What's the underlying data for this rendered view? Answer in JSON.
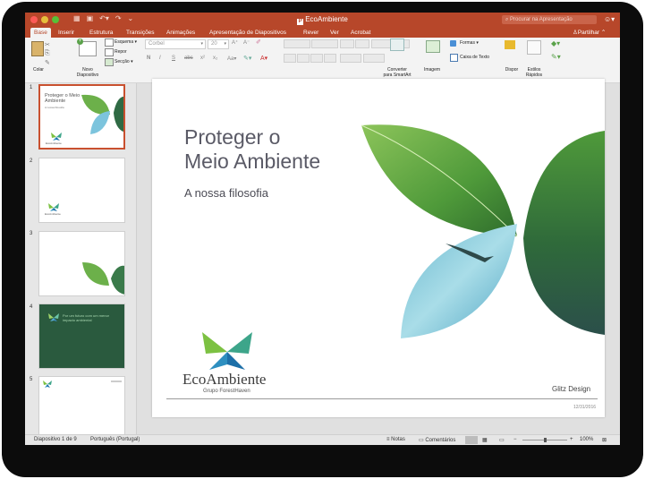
{
  "window": {
    "title": "EcoAmbiente",
    "search_placeholder": "Procurar na Apresentação",
    "share_label": "Partilhar",
    "qat_icons": [
      "grid-icon",
      "save-icon",
      "undo-icon",
      "redo-icon",
      "customize-icon"
    ],
    "accent": "#b7472a"
  },
  "tabs": [
    "Base",
    "Inserir",
    "Estrutura",
    "Transições",
    "Animações",
    "Apresentação de Diapositivos",
    "Rever",
    "Ver",
    "Acrobat"
  ],
  "ribbon": {
    "paste": "Colar",
    "new_slide_line1": "Novo",
    "new_slide_line2": "Diapositivo",
    "layout": "Esquema",
    "reset": "Repor",
    "section": "Secção",
    "font_name": "Corbel",
    "font_size": "20",
    "font_buttons": [
      "N",
      "I",
      "S",
      "abc",
      "x²",
      "x₂"
    ],
    "convert_line1": "Converter",
    "convert_line2": "para SmartArt",
    "picture": "Imagem",
    "shapes": "Formas",
    "textbox": "Caixa de Texto",
    "arrange": "Dispor",
    "quick_styles_line1": "Estilos",
    "quick_styles_line2": "Rápidos"
  },
  "thumbnails": [
    {
      "num": "1",
      "title": "Proteger o Meio Ambiente",
      "subtitle": "A nossa filosofia",
      "brand": "EcoAmbiente"
    },
    {
      "num": "2",
      "brand": "EcoAmbiente"
    },
    {
      "num": "3"
    },
    {
      "num": "4",
      "text": "Por um futuro com um menor impacto ambiental",
      "bg": "#2a5a3e"
    },
    {
      "num": "5"
    }
  ],
  "slide": {
    "title_line1": "Proteger o",
    "title_line2": "Meio Ambiente",
    "subtitle": "A nossa filosofia",
    "brand": "EcoAmbiente",
    "brand_sub": "Grupo ForestHaven",
    "credit": "Glitz Design",
    "date": "12/31/2016"
  },
  "status": {
    "slide_info": "Diapositivo 1 de 9",
    "language": "Português (Portugal)",
    "notes": "Notas",
    "comments": "Comentários",
    "zoom": "100%"
  }
}
